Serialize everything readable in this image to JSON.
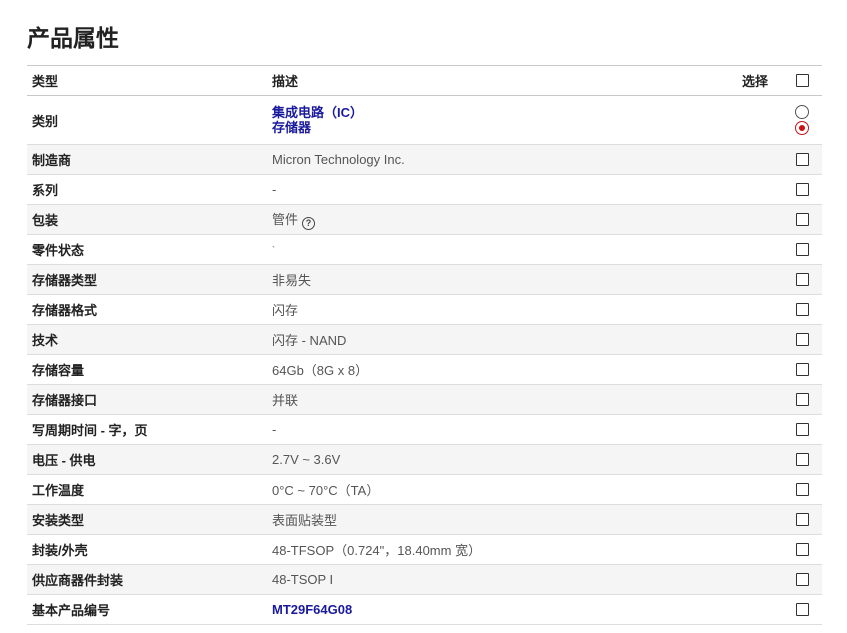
{
  "page": {
    "title": "产品属性"
  },
  "table": {
    "headers": {
      "type": "类型",
      "description": "描述",
      "select": "选择"
    },
    "category": {
      "label": "类别",
      "values": [
        "集成电路（IC）",
        "存储器"
      ]
    },
    "rows": [
      {
        "label": "制造商",
        "value": "Micron Technology Inc."
      },
      {
        "label": "系列",
        "value": "-"
      },
      {
        "label": "包装",
        "value": "管件",
        "help_icon": "help-circle-icon"
      },
      {
        "label": "零件状态",
        "value": "`"
      },
      {
        "label": "存储器类型",
        "value": "非易失"
      },
      {
        "label": "存储器格式",
        "value": "闪存"
      },
      {
        "label": "技术",
        "value": "闪存 - NAND"
      },
      {
        "label": "存储容量",
        "value": "64Gb（8G x 8）"
      },
      {
        "label": "存储器接口",
        "value": "并联"
      },
      {
        "label": "写周期时间 - 字，页",
        "value": "-"
      },
      {
        "label": "电压 - 供电",
        "value": "2.7V ~ 3.6V"
      },
      {
        "label": "工作温度",
        "value": "0°C ~ 70°C（TA）"
      },
      {
        "label": "安装类型",
        "value": "表面贴装型"
      },
      {
        "label": "封装/外壳",
        "value": "48-TFSOP（0.724\"，18.40mm 宽）"
      },
      {
        "label": "供应商器件封装",
        "value": "48-TSOP I"
      },
      {
        "label": "基本产品编号",
        "value": "MT29F64G08",
        "is_link": true
      }
    ]
  },
  "colors": {
    "link": "#1a1a9e",
    "radio_selected": "#cc1111",
    "row_alt_bg": "#f5f5f5"
  }
}
